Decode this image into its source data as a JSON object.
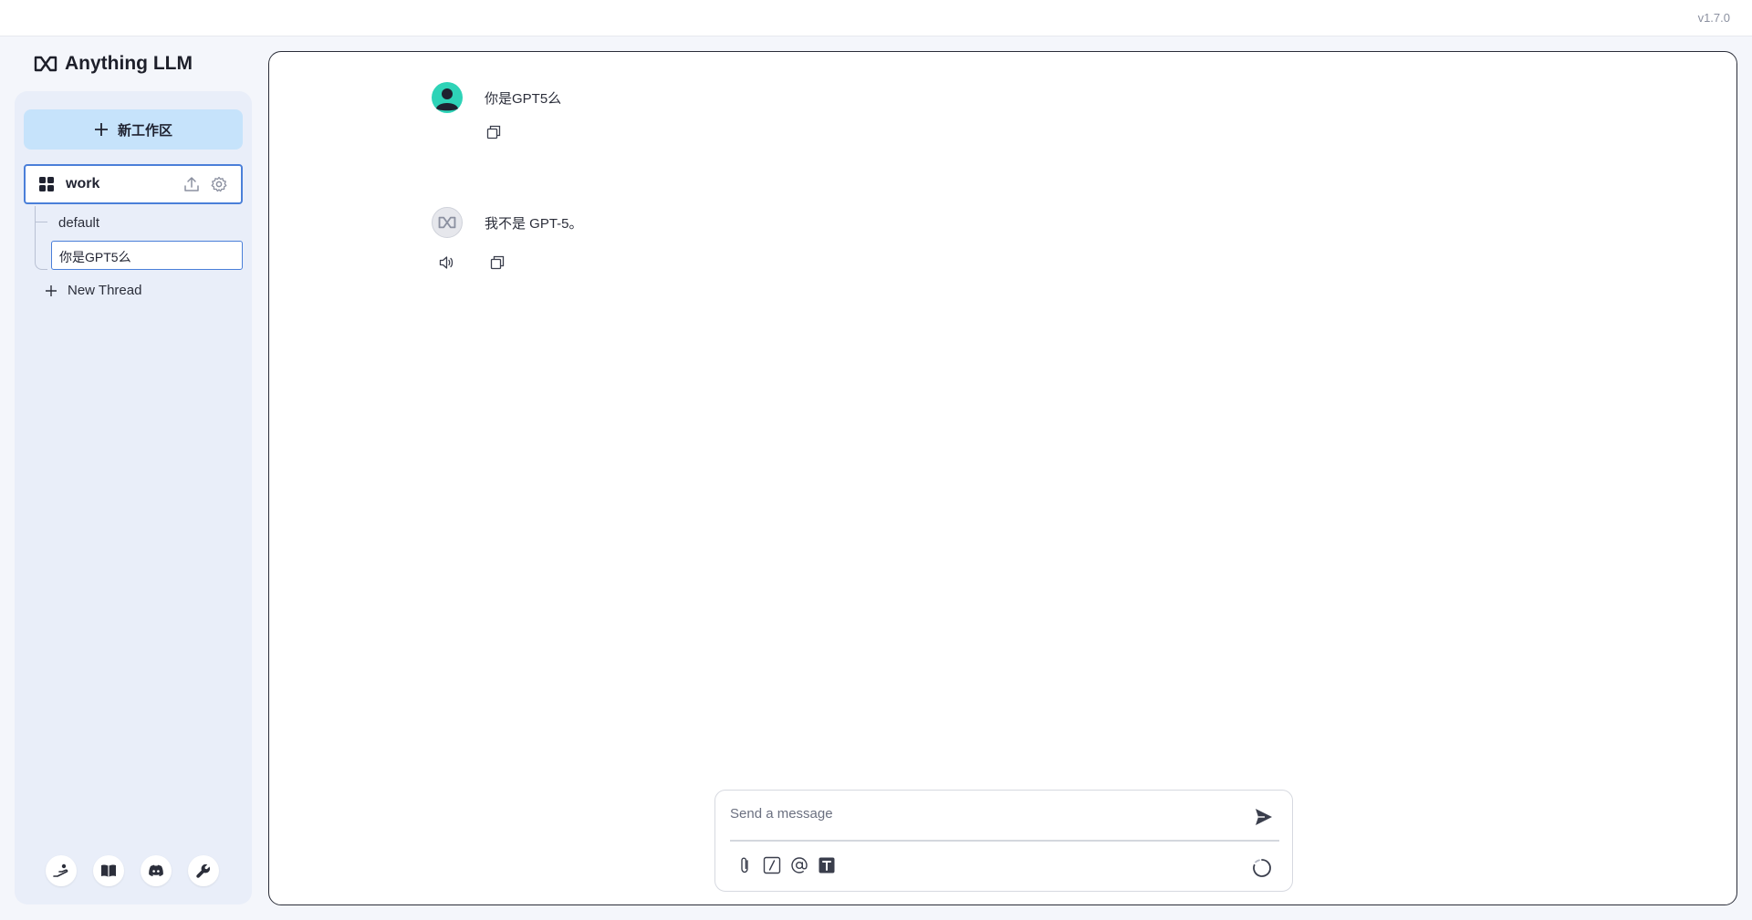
{
  "app": {
    "version": "v1.7.0",
    "logo_text": "Anything LLM"
  },
  "sidebar": {
    "new_workspace_label": "新工作区",
    "workspace": {
      "name": "work",
      "icons": [
        "upload-icon",
        "gear-icon"
      ]
    },
    "threads": [
      {
        "label": "default",
        "active": false
      },
      {
        "label": "你是GPT5么",
        "active": true
      }
    ],
    "new_thread_label": "New Thread",
    "footer_icons": [
      "community-hub-icon",
      "docs-book-icon",
      "discord-icon",
      "wrench-icon"
    ]
  },
  "chat": {
    "messages": [
      {
        "role": "user",
        "text": "你是GPT5么",
        "actions": [
          "copy-icon"
        ]
      },
      {
        "role": "assistant",
        "text": "我不是 GPT-5。",
        "actions": [
          "speaker-icon",
          "copy-icon"
        ]
      }
    ]
  },
  "composer": {
    "placeholder": "Send a message",
    "tools": [
      "paperclip-icon",
      "slash-command-icon",
      "at-mention-icon",
      "text-format-icon"
    ]
  },
  "colors": {
    "accent_border": "#4a7fd9",
    "new_workspace_bg": "#c6e3fb",
    "user_avatar": "#2ed3b7",
    "sidebar_bg": "#e9eef9"
  }
}
